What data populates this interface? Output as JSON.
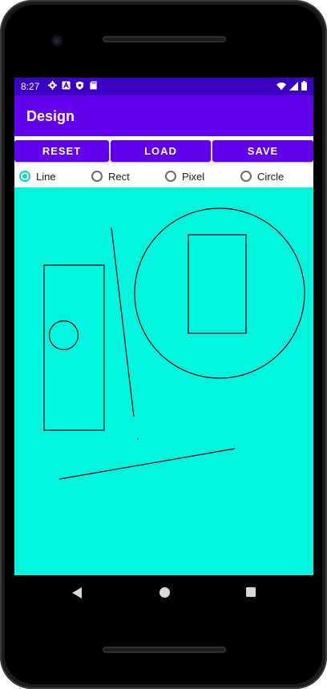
{
  "status_bar": {
    "time": "8:27",
    "left_icons": [
      "settings-icon",
      "a-badge-icon",
      "shield-icon",
      "sd-card-icon"
    ],
    "right_icons": [
      "wifi-icon",
      "signal-icon",
      "battery-icon"
    ]
  },
  "app_bar": {
    "title": "Design"
  },
  "buttons": {
    "reset": "RESET",
    "load": "LOAD",
    "save": "SAVE"
  },
  "shape_options": [
    {
      "label": "Line",
      "checked": true
    },
    {
      "label": "Rect",
      "checked": false
    },
    {
      "label": "Pixel",
      "checked": false
    },
    {
      "label": "Circle",
      "checked": false
    }
  ],
  "colors": {
    "status_bar": "#3a00c4",
    "app_bar": "#6200ee",
    "canvas_background": "#00f5df",
    "accent": "#03dac5",
    "stroke": "#000000"
  },
  "nav_bar": {
    "icons": [
      "back-icon",
      "home-icon",
      "recents-icon"
    ]
  }
}
